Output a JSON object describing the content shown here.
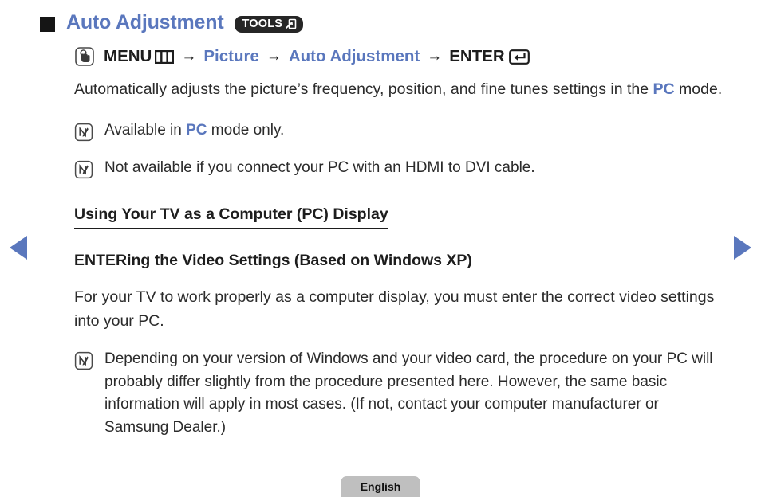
{
  "nav": {
    "prev_label": "Previous page",
    "prev_icon": "triangle-left-icon",
    "next_label": "Next page",
    "next_icon": "triangle-right-icon",
    "accent_color": "#5a77bd"
  },
  "header": {
    "bullet_icon": "square-bullet-icon",
    "title": "Auto Adjustment",
    "badge": {
      "label": "TOOLS",
      "icon": "arrow-into-box-icon"
    }
  },
  "menu_path": {
    "hand_icon": "hand-press-button-icon",
    "menu_label": "MENU",
    "menu_icon": "menu-columns-icon",
    "arrow": "→",
    "step_picture": "Picture",
    "step_auto_adjustment": "Auto Adjustment",
    "enter_label": "ENTER",
    "enter_icon": "enter-return-icon"
  },
  "body": {
    "intro_part1": "Automatically adjusts the picture’s frequency, position, and fine tunes settings in the ",
    "intro_highlight": "PC",
    "intro_part2": " mode."
  },
  "notes": [
    {
      "icon": "note-pencil-icon",
      "part1": "Available in ",
      "highlight": "PC",
      "part2": " mode only."
    },
    {
      "icon": "note-pencil-icon",
      "part1": "Not available if you connect your PC with an HDMI to DVI cable.",
      "highlight": "",
      "part2": ""
    }
  ],
  "sections": {
    "heading_display": "Using Your TV as a Computer (PC) Display",
    "heading_video_settings": "ENTERing the Video Settings (Based on Windows XP)",
    "paragraph_video_settings": "For your TV to work properly as a computer display, you must enter the correct video settings into your PC."
  },
  "final_note": {
    "icon": "note-pencil-icon",
    "text": "Depending on your version of Windows and your video card, the procedure on your PC will probably differ slightly from the procedure presented here. However, the same basic information will apply in most cases. (If not, contact your computer manufacturer or Samsung Dealer.)"
  },
  "footer": {
    "language": "English"
  }
}
